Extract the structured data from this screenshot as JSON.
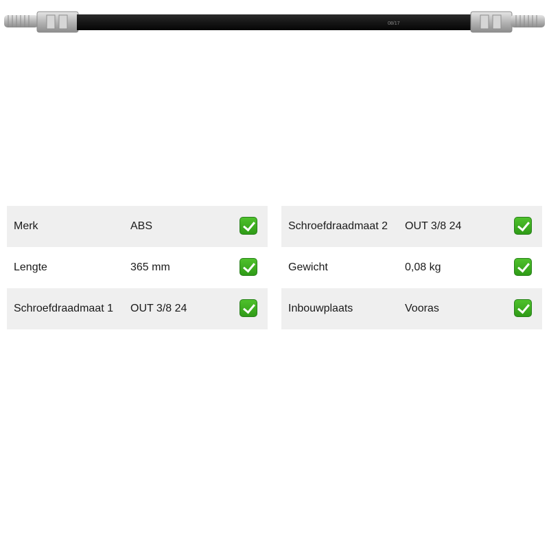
{
  "product": {
    "image_icon": "brake-hose-image",
    "marking": "08/17"
  },
  "specs_left": [
    {
      "label": "Merk",
      "value": "ABS",
      "icon": "check-icon"
    },
    {
      "label": "Lengte",
      "value": "365 mm",
      "icon": "check-icon"
    },
    {
      "label": "Schroefdraadmaat 1",
      "value": "OUT 3/8 24",
      "icon": "check-icon"
    }
  ],
  "specs_right": [
    {
      "label": "Schroefdraadmaat 2",
      "value": "OUT 3/8 24",
      "icon": "check-icon"
    },
    {
      "label": "Gewicht",
      "value": "0,08 kg",
      "icon": "check-icon"
    },
    {
      "label": "Inbouwplaats",
      "value": "Vooras",
      "icon": "check-icon"
    }
  ],
  "colors": {
    "row_shade": "#efefef",
    "check_green": "#3aad1f",
    "hose": "#1a1a1a",
    "fitting": "#b9b9b9"
  }
}
